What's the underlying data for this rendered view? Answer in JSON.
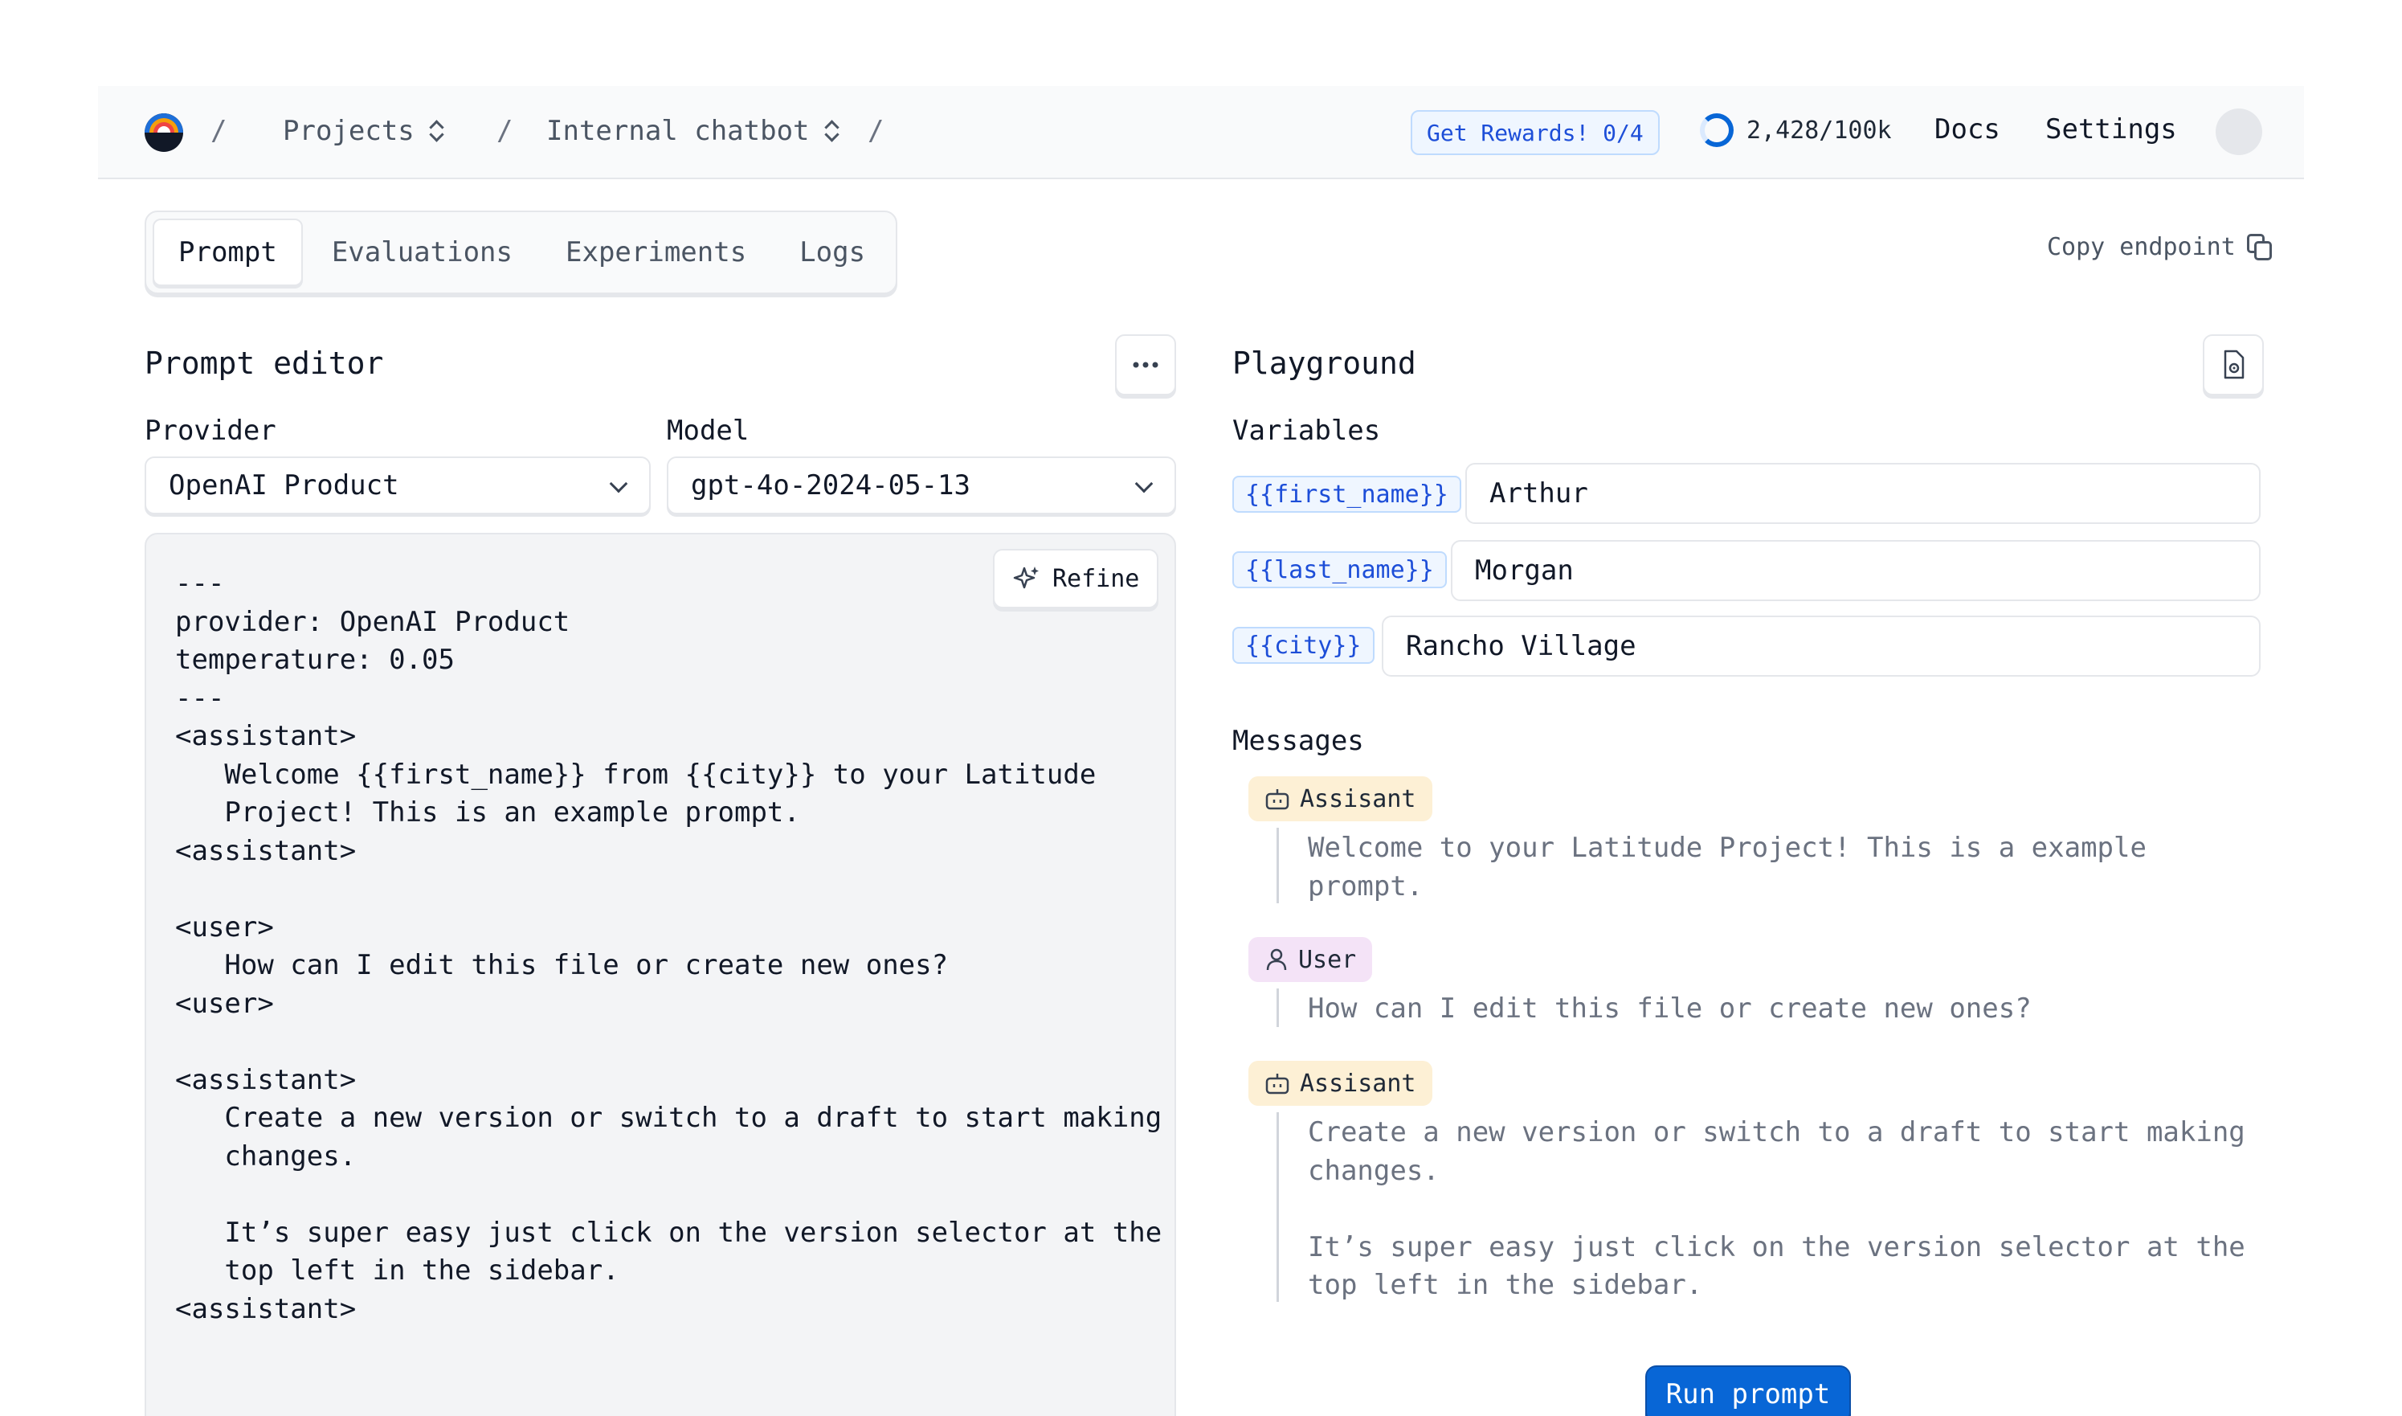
{
  "header": {
    "breadcrumbs": [
      {
        "label": "Projects"
      },
      {
        "label": "Internal chatbot"
      }
    ],
    "rewards_label": "Get Rewards! 0/4",
    "usage": {
      "label": "2,428/100k",
      "fraction": 0.024
    },
    "docs_label": "Docs",
    "settings_label": "Settings"
  },
  "tabs": [
    "Prompt",
    "Evaluations",
    "Experiments",
    "Logs"
  ],
  "active_tab": "Prompt",
  "copy_endpoint_label": "Copy endpoint",
  "prompt_editor": {
    "title": "Prompt editor",
    "provider_label": "Provider",
    "provider_value": "OpenAI Product",
    "model_label": "Model",
    "model_value": "gpt-4o-2024-05-13",
    "refine_label": "Refine",
    "code": "---\nprovider: OpenAI Product\ntemperature: 0.05\n---\n<assistant>\n   Welcome {{first_name}} from {{city}} to your Latitude\n   Project! This is an example prompt.\n<assistant>\n\n<user>\n   How can I edit this file or create new ones?\n<user>\n\n<assistant>\n   Create a new version or switch to a draft to start making\n   changes.\n\n   It’s super easy just click on the version selector at the\n   top left in the sidebar.\n<assistant>"
  },
  "playground": {
    "title": "Playground",
    "variables_label": "Variables",
    "variables": [
      {
        "name": "{{first_name}}",
        "value": "Arthur"
      },
      {
        "name": "{{last_name}}",
        "value": "Morgan"
      },
      {
        "name": "{{city}}",
        "value": "Rancho Village"
      }
    ],
    "messages_label": "Messages",
    "messages": [
      {
        "role": "Assisant",
        "text": "Welcome to your Latitude Project! This is a example\nprompt."
      },
      {
        "role": "User",
        "text": "How can I edit this file or create new ones?"
      },
      {
        "role": "Assisant",
        "text": "Create a new version or switch to a draft to start making\nchanges.\n\nIt’s super easy just click on the version selector at the\ntop left in the sidebar."
      }
    ],
    "run_label": "Run prompt"
  },
  "colors": {
    "accent": "#0866d6",
    "assistant_badge": "#fdf0d5",
    "user_badge": "#f4e3f7",
    "variable_tag": "#eff6ff"
  }
}
